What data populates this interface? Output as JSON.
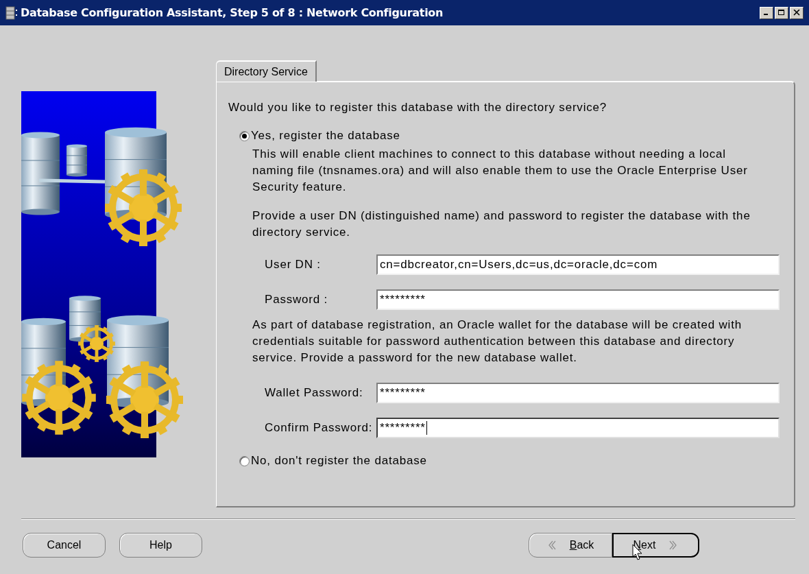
{
  "window": {
    "title": "Database Configuration Assistant, Step 5 of 8 : Network Configuration"
  },
  "tabs": [
    {
      "label": "Directory Service",
      "selected": true
    }
  ],
  "question": "Would you like to register this database with the directory service?",
  "options": [
    {
      "label": "Yes, register the database",
      "selected": true
    },
    {
      "label": "No, don't register the database",
      "selected": false
    }
  ],
  "register_section": {
    "description": "This will enable client machines to connect to this database without needing a local naming file (tnsnames.ora) and will also enable them to use the Oracle Enterprise User Security feature.",
    "instruction": "Provide a user DN (distinguished name) and password to register the database with the directory service.",
    "fields": [
      {
        "label": "User DN :",
        "value": "cn=dbcreator,cn=Users,dc=us,dc=oracle,dc=com",
        "focused": false
      },
      {
        "label": "Password :",
        "value": "*********",
        "focused": false
      }
    ],
    "wallet_note": "As part of database registration, an Oracle wallet for the database will be created with credentials suitable for password authentication between this database and directory service. Provide a password for the new database wallet.",
    "wallet_fields": [
      {
        "label": "Wallet Password:",
        "value": "*********",
        "focused": false
      },
      {
        "label": "Confirm Password:",
        "value": "*********",
        "focused": true
      }
    ]
  },
  "left_buttons": [
    {
      "label": "Cancel",
      "mnemonic_first": false,
      "default": false
    },
    {
      "label": "Help",
      "mnemonic_first": false,
      "default": false
    }
  ],
  "nav_buttons": [
    {
      "kind": "back",
      "label": "Back",
      "mnemonic_first": true,
      "default": false
    },
    {
      "kind": "next",
      "label": "Next",
      "mnemonic_first": true,
      "default": true
    }
  ]
}
